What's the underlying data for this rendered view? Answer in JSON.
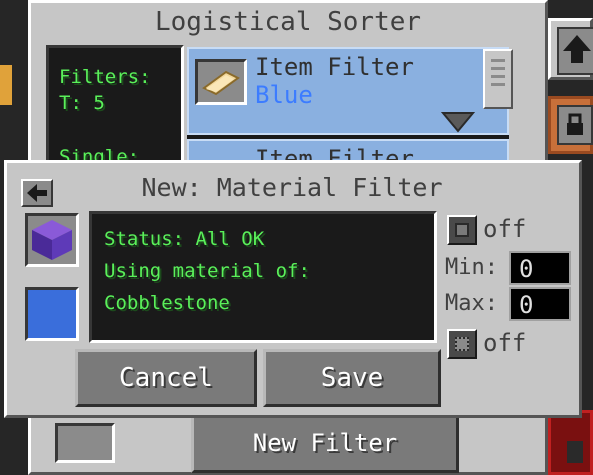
{
  "background": {
    "title": "Logistical Sorter",
    "info_lines": [
      "Filters:",
      "T: 5",
      "Single:"
    ],
    "filter_item_1": {
      "type": "Item Filter",
      "color": "Blue"
    },
    "filter_item_2": {
      "type": "Item Filter"
    },
    "new_filter_label": "New Filter"
  },
  "dialog": {
    "title": "New: Material Filter",
    "status_lines": [
      "Status: All OK",
      "Using material of:",
      "Cobblestone"
    ],
    "toggle_1": "off",
    "toggle_2": "off",
    "min_label": "Min:",
    "min_value": "0",
    "max_label": "Max:",
    "max_value": "0",
    "cancel_label": "Cancel",
    "save_label": "Save",
    "selected_color": "#3a6edb"
  },
  "icons": [
    "back-arrow-icon",
    "purple-block-icon",
    "paper-icon",
    "upload-icon",
    "lock-icon",
    "scroll-down-icon"
  ]
}
